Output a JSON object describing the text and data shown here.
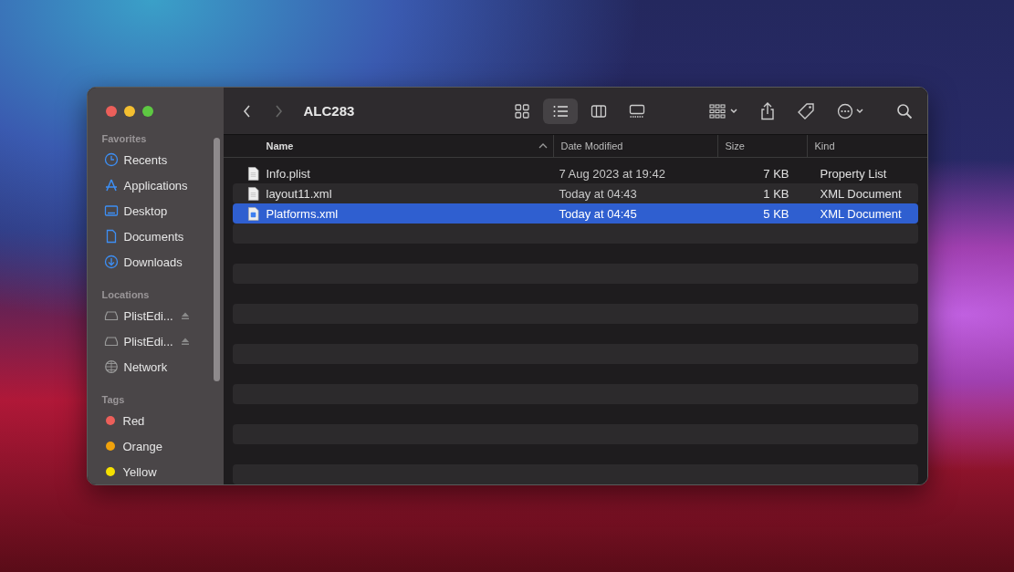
{
  "window": {
    "title": "ALC283"
  },
  "toolbar": {
    "view_modes": [
      {
        "kind": "icons",
        "selected": false
      },
      {
        "kind": "list",
        "selected": true
      },
      {
        "kind": "columns",
        "selected": false
      },
      {
        "kind": "gallery",
        "selected": false
      }
    ]
  },
  "sidebar": {
    "sections": [
      {
        "title": "Favorites",
        "items": [
          {
            "label": "Recents",
            "kind": "clock"
          },
          {
            "label": "Applications",
            "kind": "apps"
          },
          {
            "label": "Desktop",
            "kind": "desktop"
          },
          {
            "label": "Documents",
            "kind": "doc"
          },
          {
            "label": "Downloads",
            "kind": "download"
          }
        ]
      },
      {
        "title": "Locations",
        "items": [
          {
            "label": "PlistEdi...",
            "kind": "drive"
          },
          {
            "label": "PlistEdi...",
            "kind": "drive"
          },
          {
            "label": "Network",
            "kind": "globe"
          }
        ]
      },
      {
        "title": "Tags",
        "items": [
          {
            "label": "Red",
            "kind": "tag",
            "color": "#ec5f5a"
          },
          {
            "label": "Orange",
            "kind": "tag",
            "color": "#f0a20c"
          },
          {
            "label": "Yellow",
            "kind": "tag",
            "color": "#f5e000"
          }
        ]
      }
    ]
  },
  "table": {
    "columns": [
      {
        "label": "Name",
        "sorted": true
      },
      {
        "label": "Date Modified",
        "sorted": false
      },
      {
        "label": "Size",
        "sorted": false
      },
      {
        "label": "Kind",
        "sorted": false
      }
    ],
    "rows": [
      {
        "name": "Info.plist",
        "date": "7 Aug 2023 at 19:42",
        "size": "7 KB",
        "kind": "Property List",
        "selected": false
      },
      {
        "name": "layout11.xml",
        "date": "Today at 04:43",
        "size": "1 KB",
        "kind": "XML Document",
        "selected": false
      },
      {
        "name": "Platforms.xml",
        "date": "Today at 04:45",
        "size": "5 KB",
        "kind": "XML Document",
        "selected": true
      }
    ]
  }
}
